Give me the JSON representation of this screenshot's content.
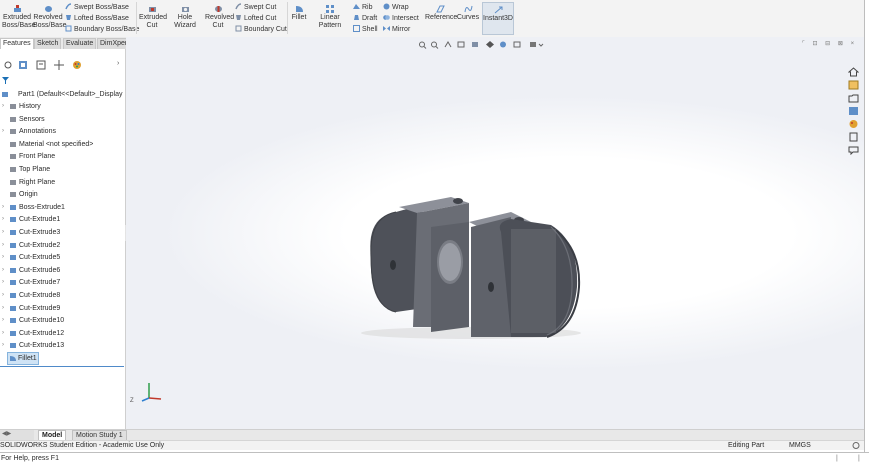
{
  "ribbon": {
    "extruded_boss": "Extruded Boss/Base",
    "revolved_boss": "Revolved Boss/Base",
    "swept_boss": "Swept Boss/Base",
    "lofted_boss": "Lofted Boss/Base",
    "boundary_boss": "Boundary Boss/Base",
    "extruded_cut": "Extruded Cut",
    "hole_wizard": "Hole Wizard",
    "revolved_cut": "Revolved Cut",
    "swept_cut": "Swept Cut",
    "lofted_cut": "Lofted Cut",
    "boundary_cut": "Boundary Cut",
    "fillet": "Fillet",
    "linear_pattern": "Linear Pattern",
    "rib": "Rib",
    "draft": "Draft",
    "shell": "Shell",
    "wrap": "Wrap",
    "intersect": "Intersect",
    "mirror": "Mirror",
    "reference": "Reference",
    "curves": "Curves",
    "instant3d": "Instant3D"
  },
  "manager_tabs": [
    "Features",
    "Sketch",
    "Evaluate",
    "DimXpert"
  ],
  "tree": {
    "part_name": "Part1 (Default<<Default>_Display",
    "items": [
      {
        "label": "History",
        "icon": "history-icon",
        "expandable": true
      },
      {
        "label": "Sensors",
        "icon": "sensors-icon",
        "expandable": false
      },
      {
        "label": "Annotations",
        "icon": "annotations-icon",
        "expandable": true
      },
      {
        "label": "Material <not specified>",
        "icon": "material-icon",
        "expandable": false
      },
      {
        "label": "Front Plane",
        "icon": "plane-icon",
        "expandable": false
      },
      {
        "label": "Top Plane",
        "icon": "plane-icon",
        "expandable": false
      },
      {
        "label": "Right Plane",
        "icon": "plane-icon",
        "expandable": false
      },
      {
        "label": "Origin",
        "icon": "origin-icon",
        "expandable": false
      },
      {
        "label": "Boss-Extrude1",
        "icon": "feature-icon",
        "expandable": true
      },
      {
        "label": "Cut-Extrude1",
        "icon": "feature-icon",
        "expandable": true
      },
      {
        "label": "Cut-Extrude3",
        "icon": "feature-icon",
        "expandable": true
      },
      {
        "label": "Cut-Extrude2",
        "icon": "feature-icon",
        "expandable": true
      },
      {
        "label": "Cut-Extrude5",
        "icon": "feature-icon",
        "expandable": true
      },
      {
        "label": "Cut-Extrude6",
        "icon": "feature-icon",
        "expandable": true
      },
      {
        "label": "Cut-Extrude7",
        "icon": "feature-icon",
        "expandable": true
      },
      {
        "label": "Cut-Extrude8",
        "icon": "feature-icon",
        "expandable": true
      },
      {
        "label": "Cut-Extrude9",
        "icon": "feature-icon",
        "expandable": true
      },
      {
        "label": "Cut-Extrude10",
        "icon": "feature-icon",
        "expandable": true
      },
      {
        "label": "Cut-Extrude12",
        "icon": "feature-icon",
        "expandable": true
      },
      {
        "label": "Cut-Extrude13",
        "icon": "feature-icon",
        "expandable": true
      }
    ],
    "selected": "Fillet1"
  },
  "bottom_tabs": [
    "Model",
    "Motion Study 1"
  ],
  "status": {
    "edition": "SOLIDWORKS Student Edition - Academic Use Only",
    "mode": "Editing Part",
    "units": "MMGS"
  },
  "prompt": "For Help, press F1",
  "colors": {
    "ribbon_bg": "#f3f3f3",
    "selection": "#cfe3f5",
    "part": "#5d6068",
    "accent": "#1a6fb5"
  }
}
